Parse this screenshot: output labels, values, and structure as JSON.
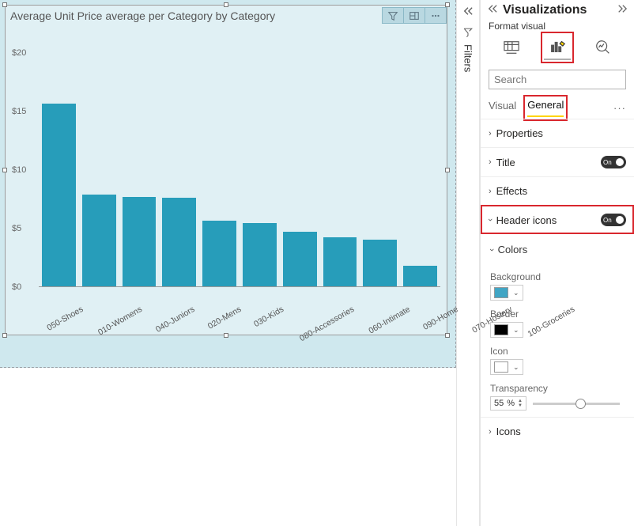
{
  "canvas": {
    "visual_title": "Average Unit Price average per Category by Category"
  },
  "chart_data": {
    "type": "bar",
    "title": "Average Unit Price average per Category by Category",
    "xlabel": "",
    "ylabel": "",
    "ylim": [
      0,
      20
    ],
    "yticks": [
      0,
      5,
      10,
      15,
      20
    ],
    "categories": [
      "050-Shoes",
      "010-Womens",
      "040-Juniors",
      "020-Mens",
      "030-Kids",
      "080-Accessories",
      "060-Intimate",
      "090-Home",
      "070-Hosiery",
      "100-Groceries"
    ],
    "values": [
      14.5,
      7.3,
      7.1,
      7.0,
      5.2,
      5.0,
      4.3,
      3.9,
      3.7,
      1.6
    ]
  },
  "filters": {
    "label": "Filters"
  },
  "panel": {
    "title": "Visualizations",
    "subhead": "Format visual",
    "search_placeholder": "Search",
    "subtabs": {
      "visual": "Visual",
      "general": "General"
    },
    "sections": {
      "properties": "Properties",
      "title": "Title",
      "effects": "Effects",
      "header_icons": "Header icons",
      "colors": "Colors",
      "icons": "Icons"
    },
    "toggles": {
      "title_on": "On",
      "header_on": "On"
    },
    "colors": {
      "background_label": "Background",
      "background_value": "#41a5c4",
      "border_label": "Border",
      "border_value": "#000000",
      "icon_label": "Icon",
      "icon_value": "#ffffff",
      "transparency_label": "Transparency",
      "transparency_value": "55",
      "transparency_suffix": " %"
    }
  }
}
